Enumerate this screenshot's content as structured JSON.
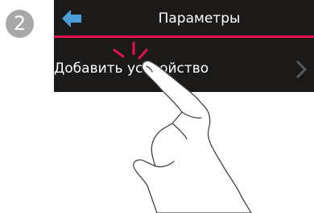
{
  "step": {
    "number": "2"
  },
  "header": {
    "title": "Параметры",
    "back_icon": "back-arrow-icon"
  },
  "menu": {
    "items": [
      {
        "label": "Добавить устройство",
        "icon": "chevron-right-icon"
      }
    ]
  },
  "colors": {
    "screen_bg": "#1c1a18",
    "accent": "#e0134f",
    "text": "#ffffff",
    "back_icon": "#4a9fd8",
    "chevron": "#595959",
    "badge": "#a8a8a8"
  }
}
